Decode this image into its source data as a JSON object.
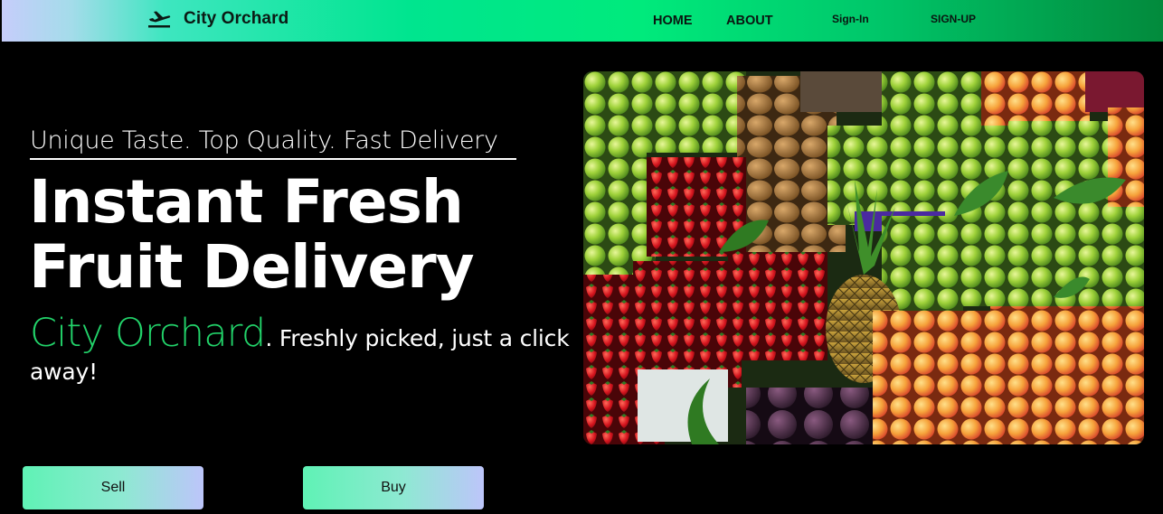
{
  "navbar": {
    "brand_name": "City Orchard",
    "brand_icon": "airplane-icon",
    "links": [
      "HOME",
      "ABOUT",
      "Sign-In",
      "SIGN-UP"
    ]
  },
  "hero": {
    "tagline": "Unique Taste. Top Quality. Fast Delivery",
    "headline_line1": "Instant Fresh",
    "headline_line2": "Fruit Delivery",
    "sub_brand": "City Orchard",
    "sub_text": ". Freshly picked, just a click away!"
  },
  "buttons": {
    "sell": "Sell",
    "buy": "Buy"
  },
  "colors": {
    "accent_green": "#22d36a",
    "page_background": "#000000"
  }
}
